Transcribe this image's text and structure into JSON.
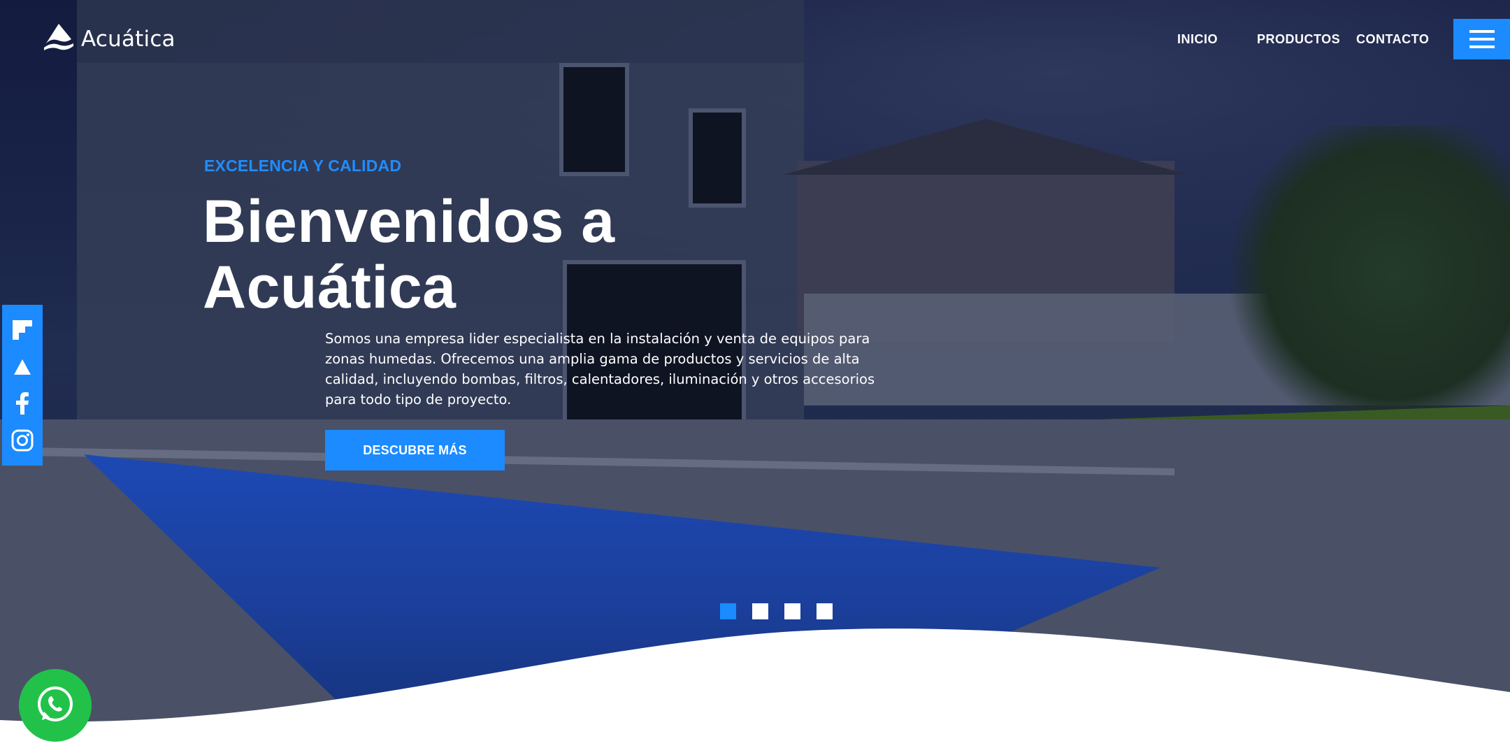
{
  "brand": {
    "name": "Acuática",
    "logo_icon": "mountain-wave-logo"
  },
  "nav": {
    "items": [
      "INICIO",
      "PRODUCTOS",
      "CONTACTO"
    ],
    "menu_icon": "hamburger-icon"
  },
  "hero": {
    "kicker": "EXCELENCIA Y CALIDAD",
    "title_line1": "Bienvenidos a",
    "title_line2": "Acuática",
    "description": "Somos una empresa lider especialista en la instalación y venta de equipos para zonas humedas. Ofrecemos una amplia gama de productos y servicios de alta calidad, incluyendo bombas, filtros, calentadores, iluminación y otros accesorios para todo tipo de proyecto.",
    "cta": "DESCUBRE MÁS"
  },
  "social": {
    "icons": [
      "flipboard-icon",
      "triangle-icon",
      "facebook-icon",
      "instagram-icon"
    ]
  },
  "slider": {
    "total": 4,
    "active_index": 1
  },
  "colors": {
    "accent": "#1b8bff",
    "whatsapp": "#22c24a",
    "text": "#ffffff"
  }
}
